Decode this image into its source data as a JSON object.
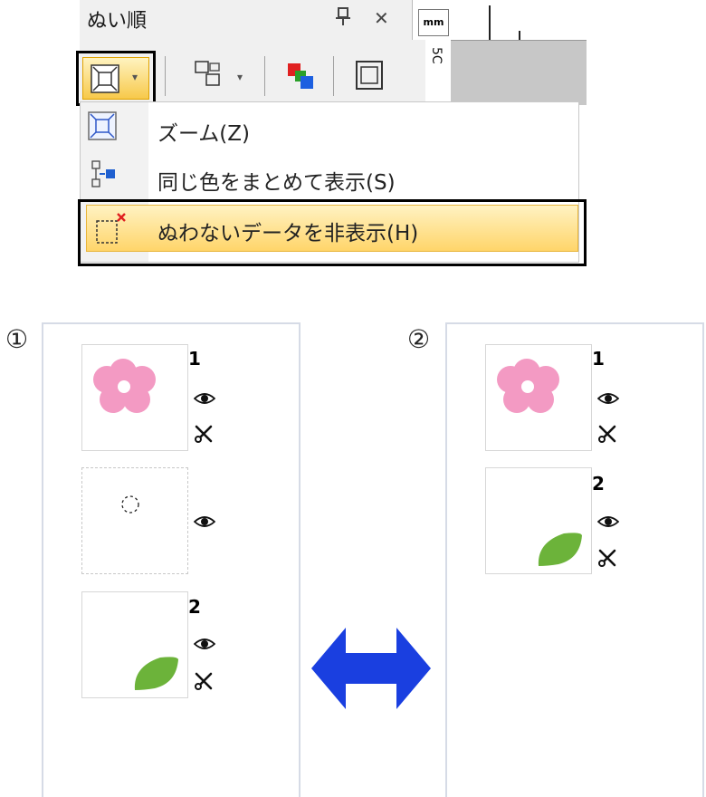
{
  "panel": {
    "title": "ぬい順",
    "ruler_unit": "mm",
    "ruler_number": "5C"
  },
  "toolbar": {
    "zoom_button_icon": "zoom-frame-icon",
    "caret": "▾",
    "icons": [
      "group-view-icon",
      "color-order-icon",
      "frame-icon"
    ]
  },
  "menu": {
    "items": [
      {
        "label": "ズーム(Z)",
        "icon": "zoom-frame-icon"
      },
      {
        "label": "同じ色をまとめて表示(S)",
        "icon": "group-color-icon"
      },
      {
        "label": "ぬわないデータを非表示(H)",
        "icon": "hide-unsewn-icon"
      }
    ]
  },
  "comparison": {
    "left": {
      "marker": "①",
      "items": [
        {
          "number": "1",
          "thumbnail": "pink-flower",
          "visible": true,
          "sewn": true
        },
        {
          "number": "",
          "thumbnail": "unsewn-circle",
          "visible": true,
          "sewn": false
        },
        {
          "number": "2",
          "thumbnail": "green-leaf",
          "visible": true,
          "sewn": true
        }
      ]
    },
    "right": {
      "marker": "②",
      "items": [
        {
          "number": "1",
          "thumbnail": "pink-flower",
          "visible": true,
          "sewn": true
        },
        {
          "number": "2",
          "thumbnail": "green-leaf",
          "visible": true,
          "sewn": true
        }
      ]
    },
    "arrow_color": "#1a3fe0"
  },
  "colors": {
    "flower": "#f39ac3",
    "leaf": "#6cb33a",
    "highlight": "#ffd56a"
  }
}
